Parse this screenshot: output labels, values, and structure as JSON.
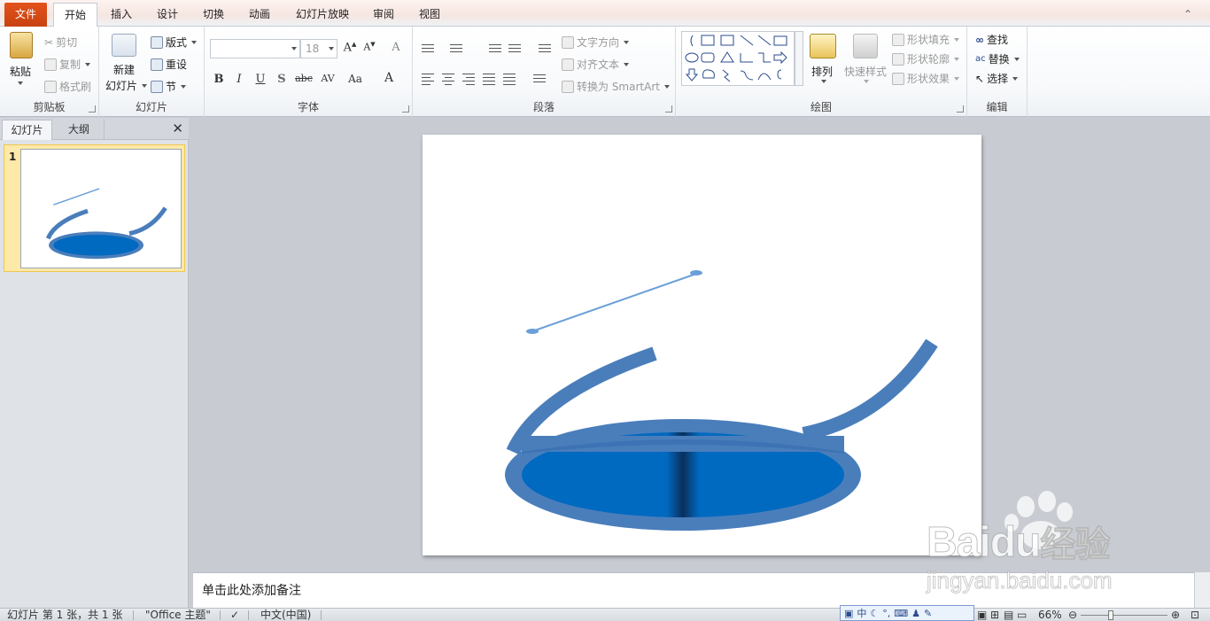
{
  "tabs": [
    {
      "label": "文件"
    },
    {
      "label": "开始"
    },
    {
      "label": "插入"
    },
    {
      "label": "设计"
    },
    {
      "label": "切换"
    },
    {
      "label": "动画"
    },
    {
      "label": "幻灯片放映"
    },
    {
      "label": "审阅"
    },
    {
      "label": "视图"
    }
  ],
  "ribbon": {
    "clipboard": {
      "label": "剪贴板",
      "paste": "粘贴",
      "cut": "剪切",
      "copy": "复制",
      "format_painter": "格式刷"
    },
    "slides": {
      "label": "幻灯片",
      "new_slide_1": "新建",
      "new_slide_2": "幻灯片",
      "layout": "版式",
      "reset": "重设",
      "section": "节"
    },
    "font": {
      "label": "字体",
      "font_name": "",
      "font_size": "18"
    },
    "paragraph": {
      "label": "段落",
      "text_direction": "文字方向",
      "align_text": "对齐文本",
      "smartart": "转换为 SmartArt"
    },
    "drawing": {
      "label": "绘图",
      "arrange": "排列",
      "quick_styles": "快速样式",
      "shape_fill": "形状填充",
      "shape_outline": "形状轮廓",
      "shape_effects": "形状效果"
    },
    "editing": {
      "label": "编辑",
      "find": "查找",
      "replace": "替换",
      "select": "选择"
    }
  },
  "left_panel": {
    "tabs": [
      "幻灯片",
      "大纲"
    ],
    "slide_number": "1"
  },
  "notes": {
    "placeholder": "单击此处添加备注"
  },
  "status": {
    "slide_info": "幻灯片 第 1 张，共 1 张",
    "theme": "\"Office 主题\"",
    "language": "中文(中国)",
    "zoom": "66%"
  },
  "ime": {
    "mode": "中"
  },
  "watermark": {
    "brand": "Bai",
    "brand2": "du",
    "suffix": "经验",
    "url": "jingyan.baidu.com"
  },
  "colors": {
    "file_tab": "#d44a15",
    "shape_stroke": "#4a7ebb",
    "shape_fill": "#0069c0",
    "line": "#6a9fd8"
  }
}
